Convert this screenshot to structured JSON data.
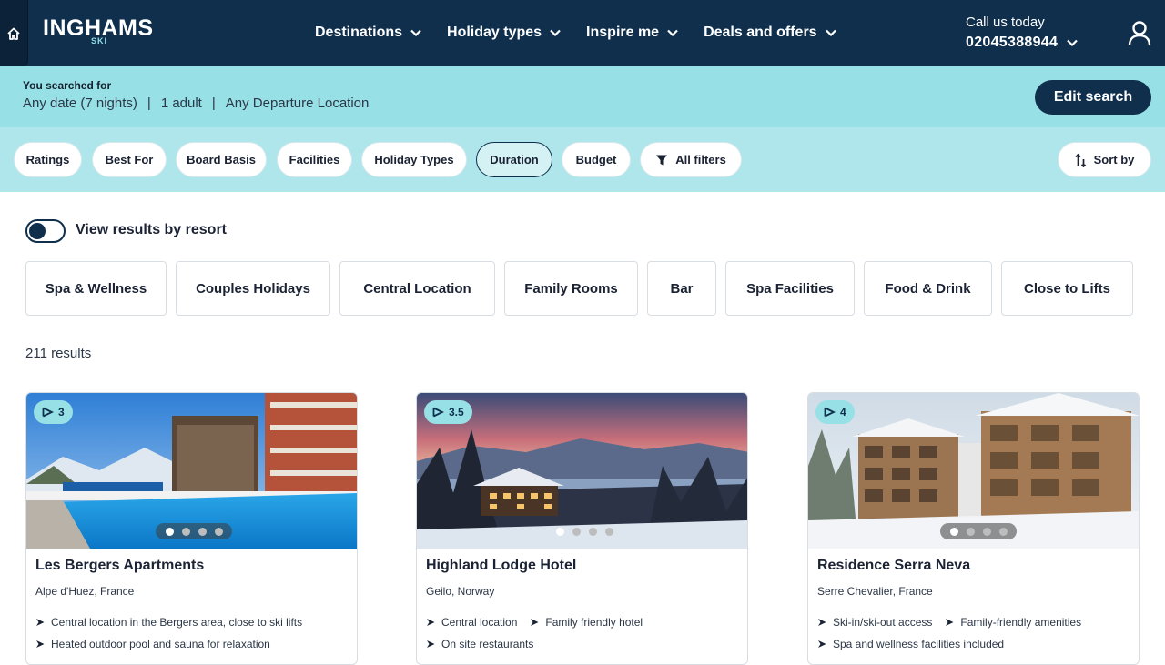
{
  "header": {
    "logo": "INGHAMS",
    "logo_sub": "SKI",
    "nav": [
      "Destinations",
      "Holiday types",
      "Inspire me",
      "Deals and offers"
    ],
    "call_label": "Call us today",
    "phone": "02045388944"
  },
  "search": {
    "label": "You searched for",
    "date": "Any date (7 nights)",
    "adults": "1 adult",
    "departure": "Any Departure Location",
    "separator": "|",
    "edit_label": "Edit search"
  },
  "filters": {
    "chips": [
      "Ratings",
      "Best For",
      "Board Basis",
      "Facilities",
      "Holiday Types",
      "Duration",
      "Budget"
    ],
    "active": "Duration",
    "all_filters": "All filters",
    "sort": "Sort by"
  },
  "view_by_resort": "View results by resort",
  "tags": [
    "Spa & Wellness",
    "Couples Holidays",
    "Central Location",
    "Family Rooms",
    "Bar",
    "Spa Facilities",
    "Food & Drink",
    "Close to Lifts"
  ],
  "results_count": "211 results",
  "cards": [
    {
      "rating": "3",
      "title": "Les Bergers Apartments",
      "location": "Alpe d'Huez, France",
      "features": [
        "Central location in the Bergers area, close to ski lifts",
        "Heated outdoor pool and sauna for relaxation"
      ]
    },
    {
      "rating": "3.5",
      "title": "Highland Lodge Hotel",
      "location": "Geilo, Norway",
      "features": [
        "Central location",
        "Family friendly hotel",
        "On site restaurants"
      ]
    },
    {
      "rating": "4",
      "title": "Residence Serra Neva",
      "location": "Serre Chevalier, France",
      "features": [
        "Ski-in/ski-out access",
        "Family-friendly amenities",
        "Spa and wellness facilities included"
      ]
    }
  ],
  "colors": {
    "navy": "#0f2f4d",
    "aqua": "#97e0e6",
    "aqua_light": "#aee6eb"
  },
  "icons": {
    "home": "home-icon",
    "chevron": "chevron-down-icon",
    "account": "user-icon",
    "filter": "filter-icon",
    "sort": "sort-icon",
    "rating": "rating-flag-icon",
    "feature": "chevron-right-icon"
  }
}
